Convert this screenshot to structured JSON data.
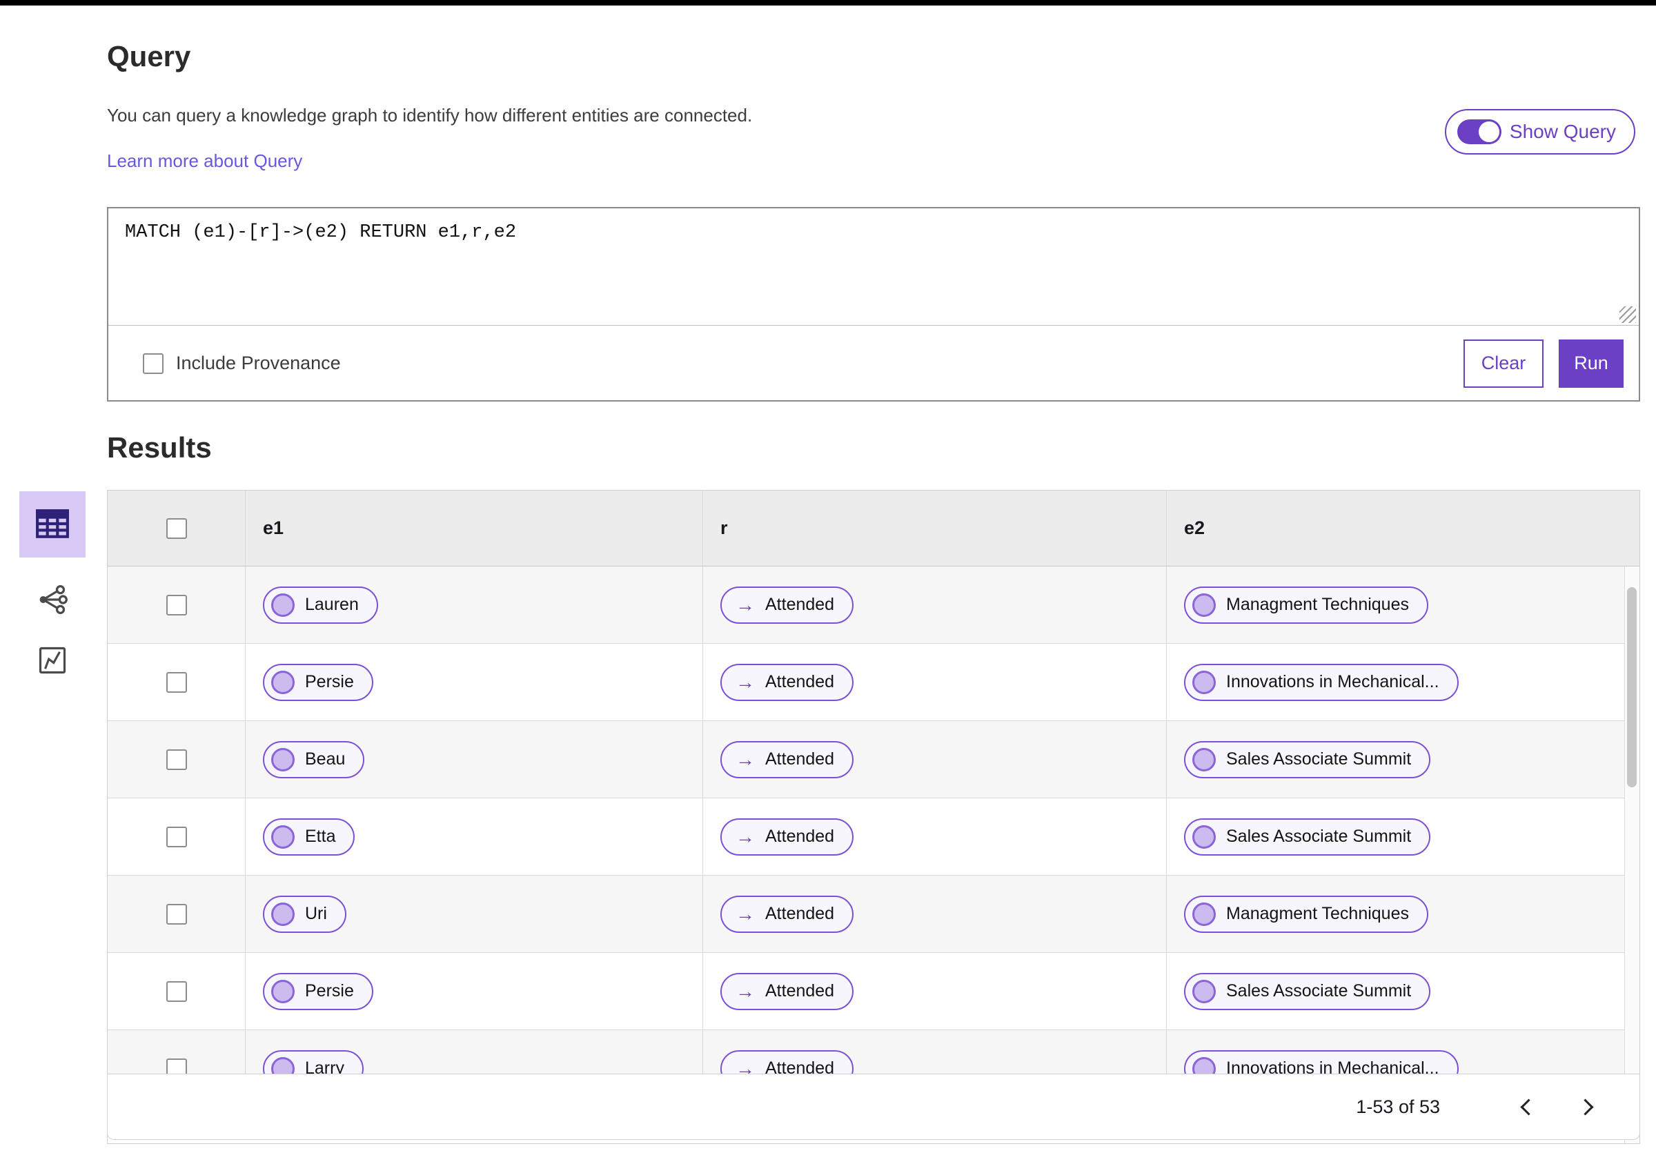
{
  "colors": {
    "accent_purple": "#6b40c4",
    "pill_border": "#7b50d2",
    "pill_background": "#f8f6fd",
    "node_circle_fill": "#ccbbee",
    "node_circle_border": "#8a64d8",
    "selected_view_background": "#d9c9f6",
    "link_purple": "#6659e0",
    "table_header_background": "#ececec",
    "alt_row_background": "#f6f6f6"
  },
  "query": {
    "title": "Query",
    "description": "You can query a knowledge graph to identify how different entities are connected.",
    "learn_more_link": "Learn more about Query",
    "show_query_label": "Show Query",
    "show_query_on": true,
    "editor_text": "MATCH (e1)-[r]->(e2) RETURN e1,r,e2",
    "include_provenance_label": "Include Provenance",
    "include_provenance_checked": false,
    "clear_button": "Clear",
    "run_button": "Run"
  },
  "results": {
    "title": "Results",
    "views": [
      "table-view",
      "graph-view",
      "chart-view"
    ],
    "selected_view": "table-view",
    "table": {
      "columns": [
        "e1",
        "r",
        "e2"
      ],
      "relation_arrow": "→",
      "rows": [
        {
          "e1": "Lauren",
          "r": "Attended",
          "e2": "Managment Techniques"
        },
        {
          "e1": "Persie",
          "r": "Attended",
          "e2": "Innovations in Mechanical..."
        },
        {
          "e1": "Beau",
          "r": "Attended",
          "e2": "Sales Associate Summit"
        },
        {
          "e1": "Etta",
          "r": "Attended",
          "e2": "Sales Associate Summit"
        },
        {
          "e1": "Uri",
          "r": "Attended",
          "e2": "Managment Techniques"
        },
        {
          "e1": "Persie",
          "r": "Attended",
          "e2": "Sales Associate Summit"
        },
        {
          "e1": "Larry",
          "r": "Attended",
          "e2": "Innovations in Mechanical..."
        }
      ]
    },
    "pagination": {
      "range_text": "1-53 of 53",
      "prev_icon": "chevron-left-icon",
      "next_icon": "chevron-right-icon"
    }
  }
}
